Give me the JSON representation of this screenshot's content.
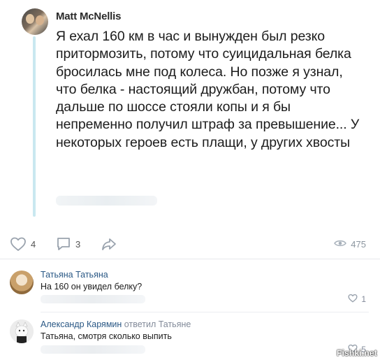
{
  "post": {
    "author": "Matt McNellis",
    "text": "Я ехал 160 км в час и вынужден был резко притормозить, потому что суицидальная белка бросилась мне под колеса. Но позже я узнал, что белка  - настоящий дружбан, потому что дальше по шоссе стояли копы и я бы непременно получил штраф за превышение... У некоторых героев есть плащи, у других хвосты"
  },
  "actions": {
    "likes": "4",
    "comments": "3",
    "views": "475",
    "icons": {
      "like": "heart-icon",
      "comment": "comment-icon",
      "share": "share-icon",
      "views": "eye-icon"
    },
    "colors": {
      "icon": "#99a2ad",
      "views": "#8c96a0"
    }
  },
  "comments": [
    {
      "author": "Татьяна Татьяна",
      "text": "На 160 он увидел белку?",
      "likes": "1"
    },
    {
      "author": "Александр Карямин",
      "reply_label": "ответил Татьяне",
      "text": "Татьяна, смотря сколько выпить",
      "likes": "5"
    }
  ],
  "watermark": "Fishki.net",
  "colors": {
    "link": "#2a5885",
    "muted": "#828a99",
    "quote_bar": "#c9e8f0"
  }
}
